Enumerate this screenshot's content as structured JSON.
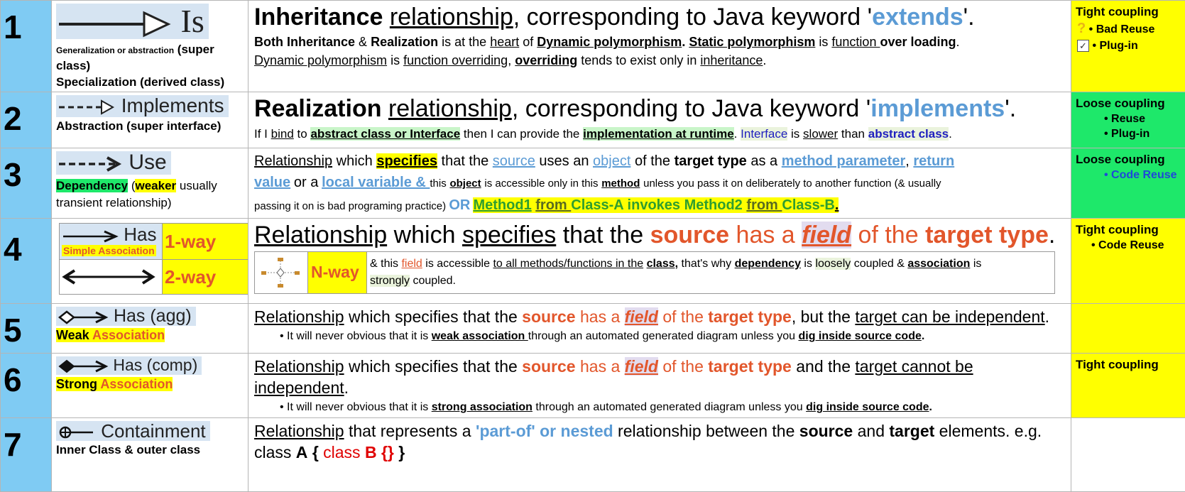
{
  "rows": [
    {
      "num": "1",
      "symbol": "Is",
      "left_small": "Generalization or abstraction",
      "left_paren": "(super class)",
      "left_line2": "Specialization (derived class)",
      "title_pre": "Inheritance",
      "title_rel": "relationship",
      "title_mid": ", corresponding to Java keyword '",
      "title_kw": "extends",
      "title_end": "'.",
      "l2": [
        "Both",
        "Inheritance",
        "&",
        "Realization",
        "is at the",
        "heart",
        "of",
        "Dynamic polymorphism",
        ".",
        "Static polymorphism",
        "is",
        "function ",
        "over loading",
        "."
      ],
      "l3": [
        "Dynamic polymorphism",
        "is",
        "function overriding",
        ",",
        "overriding",
        "tends to exist only in",
        "inheritance",
        "."
      ],
      "coupling": "Tight coupling",
      "coupling_items": [
        "• Bad Reuse",
        "• Plug-in"
      ]
    },
    {
      "num": "2",
      "symbol": "Implements",
      "left_line": "Abstraction (super interface)",
      "title_pre": "Realization",
      "title_rel": "relationship",
      "title_mid": ", corresponding to Java keyword '",
      "title_kw": "implements",
      "title_end": "'.",
      "l2": [
        "If I",
        "bind",
        "to",
        "abstract class or Interface",
        "then I can provide the",
        "implementation at runtime",
        ".",
        "Interface",
        "is",
        "slower",
        "than",
        "abstract class",
        "."
      ],
      "coupling": "Loose coupling",
      "coupling_items": [
        "• Reuse",
        "• Plug-in"
      ]
    },
    {
      "num": "3",
      "symbol": "Use",
      "left_dep": "Dependency",
      "left_open": " (",
      "left_weaker": "weaker",
      "left_rest": " usually",
      "left_line2": "transient relationship)",
      "l1": [
        "Relationship",
        "which",
        "specifies",
        "that the",
        "source",
        "uses an",
        "object",
        "of the",
        "target type",
        "as a",
        "method parameter",
        ",",
        "return"
      ],
      "l2": [
        "value",
        "or a",
        "local variable & ",
        "this",
        "object",
        "is accessible only in this",
        "method",
        "unless you pass it on deliberately to another function (& usually"
      ],
      "l3": [
        "passing it on is bad programing practice)",
        "OR",
        "Method1",
        "from ",
        "Class-A invokes  Method2",
        "from ",
        "Class-B",
        "."
      ],
      "coupling": "Loose coupling",
      "coupling_items": [
        "• Code Reuse"
      ]
    },
    {
      "num": "4",
      "sym1": "Has",
      "sym1_label": "Simple Association",
      "way1": "1-way",
      "way2": "2-way",
      "title": [
        "Relationship",
        "which",
        "specifies",
        "that the",
        "source",
        "has a",
        "field",
        "of the",
        "target type",
        "."
      ],
      "nway": "N-way",
      "nway_text": [
        "& this",
        "field",
        "is accessible",
        "to all methods/functions in the",
        "class,",
        "that's why",
        "dependency",
        "is",
        "loosely",
        "coupled &",
        "association",
        "is",
        "strongly",
        "coupled."
      ],
      "coupling": "Tight coupling",
      "coupling_items": [
        "• Code Reuse"
      ]
    },
    {
      "num": "5",
      "symbol": "Has (agg)",
      "left_weak": "Weak",
      "left_assoc": " Association",
      "l1": [
        "Relationship",
        "which specifies that the",
        "source",
        "has a",
        "field",
        "of the",
        "target type",
        ", but the",
        "target can be independent",
        "."
      ],
      "bullet": [
        "• It will never obvious that it is",
        "weak association ",
        "through an automated generated diagram unless you",
        "dig inside source code",
        "."
      ],
      "coupling": ""
    },
    {
      "num": "6",
      "symbol": "Has (comp)",
      "left_strong": "Strong",
      "left_assoc": " Association",
      "l1": [
        "Relationship",
        "which specifies that the",
        "source",
        "has a",
        "field",
        "of the",
        "target type",
        "and the",
        "target cannot be independent",
        "."
      ],
      "bullet": [
        "• It will never obvious that it is",
        "strong association",
        "through an automated generated diagram unless you",
        "dig inside source code",
        "."
      ],
      "coupling": "Tight coupling"
    },
    {
      "num": "7",
      "symbol": "Containment",
      "left_line": "Inner Class & outer class",
      "l1": [
        "Relationship",
        "that represents a",
        "'part-of' or nested",
        "relationship between the",
        "source",
        "and",
        "target",
        "elements. e.g."
      ],
      "l2": [
        "class",
        "A",
        "{",
        "class",
        "B",
        "{}",
        "}"
      ],
      "coupling": ""
    }
  ],
  "icons": [
    "solid-arrow-hollow-head",
    "dashed-arrow-hollow-head",
    "dashed-arrow-open-head",
    "solid-arrow",
    "double-arrow",
    "hollow-diamond-arrow",
    "filled-diamond-arrow",
    "circle-plus-line",
    "n-way-association-glyph",
    "question-mark-icon",
    "checkbox-checked-icon"
  ],
  "colors": {
    "number_col": "#7fcbf3",
    "yellow": "#ffff00",
    "green": "#1ee86a",
    "keyword_blue": "#5b9bd5",
    "orange": "#e2562b",
    "symbol_bg": "#d6e4f2"
  }
}
